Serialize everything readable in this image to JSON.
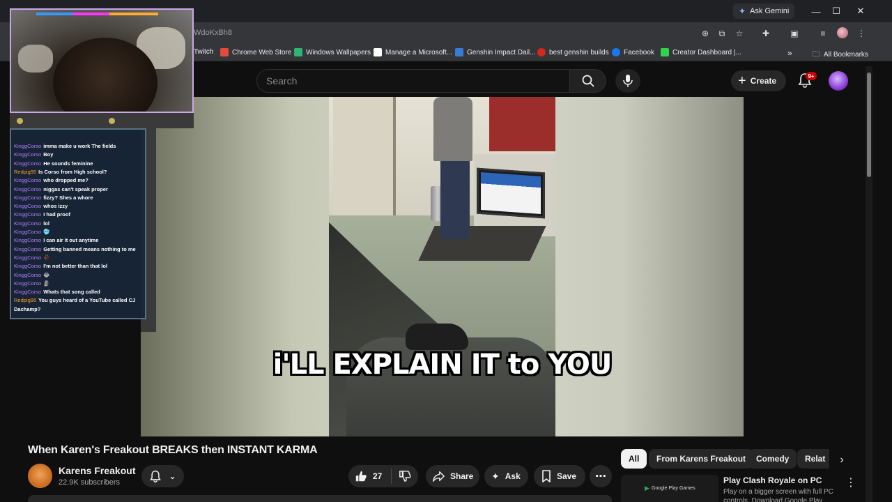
{
  "browser": {
    "gemini_label": "Ask Gemini",
    "url_fragment": "WdoKxBh8",
    "bookmarks": [
      {
        "label": "Twitch",
        "color": "#9146ff"
      },
      {
        "label": "Chrome Web Store",
        "color": "#e44b3c"
      },
      {
        "label": "Windows Wallpapers",
        "color": "#2bb673"
      },
      {
        "label": "Manage a Microsoft...",
        "color": "#ffffff"
      },
      {
        "label": "Genshin Impact Dail...",
        "color": "#3a7bd5"
      },
      {
        "label": "best genshin builds",
        "color": "#d7261e"
      },
      {
        "label": "Facebook",
        "color": "#1877f2"
      },
      {
        "label": "Creator Dashboard |...",
        "color": "#2fd34c"
      }
    ],
    "all_bookmarks_label": "All Bookmarks"
  },
  "masthead": {
    "search_placeholder": "Search",
    "create_label": "Create",
    "notification_badge": "9+"
  },
  "video": {
    "caption": "i'LL EXPLAIN IT to YOU"
  },
  "chat": {
    "messages": [
      {
        "user": "KinggCorso",
        "text": "imma make u work The fields",
        "user_color": "#b57cff"
      },
      {
        "user": "KinggCorso",
        "text": "Boy",
        "user_color": "#b57cff"
      },
      {
        "user": "KinggCorso",
        "text": "He sounds feminine",
        "user_color": "#b57cff"
      },
      {
        "user": "Redpig95",
        "text": "Is Corso from High school?",
        "user_color": "#ff9d2b"
      },
      {
        "user": "KinggCorso",
        "text": "who dropped me?",
        "user_color": "#b57cff"
      },
      {
        "user": "KinggCorso",
        "text": "niggas can't speak proper",
        "user_color": "#b57cff"
      },
      {
        "user": "KinggCorso",
        "text": "fizzy? Shes a whore",
        "user_color": "#b57cff"
      },
      {
        "user": "KinggCorso",
        "text": "whos izzy",
        "user_color": "#b57cff"
      },
      {
        "user": "KinggCorso",
        "text": "I had proof",
        "user_color": "#b57cff"
      },
      {
        "user": "KinggCorso",
        "text": "lol",
        "user_color": "#b57cff"
      },
      {
        "user": "KinggCorso",
        "text": "🥶",
        "user_color": "#b57cff"
      },
      {
        "user": "KinggCorso",
        "text": "I can air it out anytime",
        "user_color": "#b57cff"
      },
      {
        "user": "KinggCorso",
        "text": "Getting banned means nothing to me",
        "user_color": "#b57cff"
      },
      {
        "user": "KinggCorso",
        "text": "🥀",
        "user_color": "#b57cff"
      },
      {
        "user": "KinggCorso",
        "text": "I'm not better than that lol",
        "user_color": "#b57cff"
      },
      {
        "user": "KinggCorso",
        "text": "😂",
        "user_color": "#b57cff"
      },
      {
        "user": "KinggCorso",
        "text": "🗿",
        "user_color": "#b57cff"
      },
      {
        "user": "KinggCorso",
        "text": "Whats that song called",
        "user_color": "#b57cff"
      },
      {
        "user": "Redpig95",
        "text": "You guys heard of a YouTube called CJ Dachamp?",
        "user_color": "#ff9d2b"
      }
    ]
  },
  "watch": {
    "title": "When Karen's Freakout BREAKS then INSTANT KARMA",
    "channel_name": "Karens Freakout",
    "subscribers": "22.9K subscribers",
    "like_count": "27",
    "share_label": "Share",
    "ask_label": "Ask",
    "save_label": "Save"
  },
  "sidebar": {
    "chips": [
      "All",
      "From Karens Freakout",
      "Comedy",
      "Relat"
    ],
    "ad": {
      "thumb_label": "Google Play Games",
      "title": "Play Clash Royale on PC",
      "desc": "Play on a bigger screen with full PC controls. Download Google Play"
    }
  },
  "colors": {
    "background": "#0f0f0f",
    "chip_active": "#f1f1f1",
    "badge": "#cc0000"
  }
}
